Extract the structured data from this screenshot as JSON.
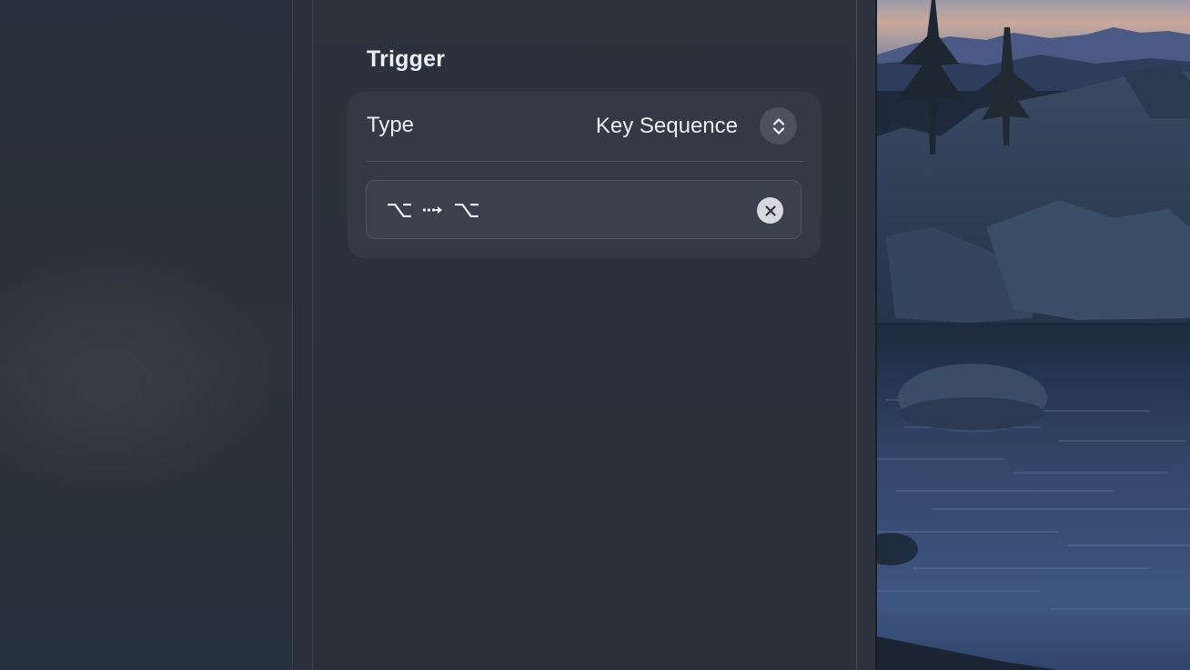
{
  "trigger": {
    "title": "Trigger",
    "type_label": "Type",
    "type_value": "Key Sequence",
    "key_sequence": {
      "first_key": "⌥",
      "second_key": "⌥"
    }
  },
  "icons": {
    "stepper": "chevron-up-down-icon",
    "clear": "clear-circle-icon",
    "sequence_arrow": "dotted-arrow-icon"
  },
  "colors": {
    "panel_background": "#2a313c",
    "card_background": "#333a45",
    "text_primary": "#e9ecf1",
    "clear_button": "#d7d9de"
  }
}
